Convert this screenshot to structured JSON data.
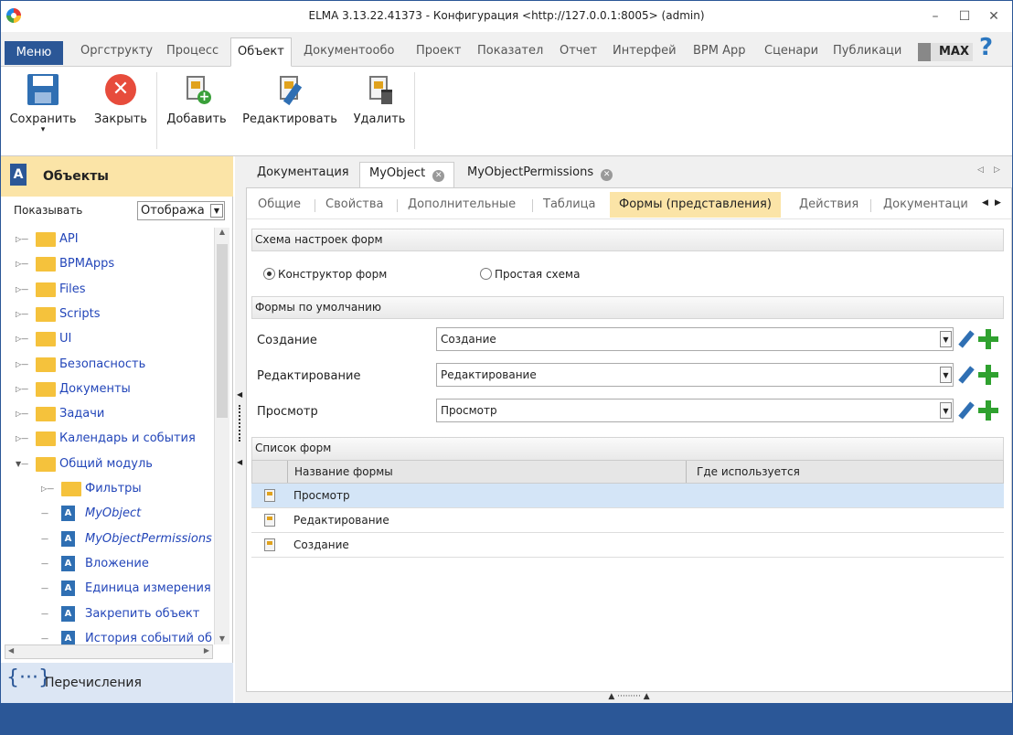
{
  "window": {
    "title": "ELMA 3.13.22.41373 - Конфигурация <http://127.0.0.1:8005> (admin)",
    "minimize": "–",
    "maximize": "☐",
    "close": "✕"
  },
  "menu": {
    "menu_label": "Меню",
    "tabs": [
      "Оргструкту",
      "Процесс",
      "Объект",
      "Документообо",
      "Проект",
      "Показател",
      "Отчет",
      "Интерфей",
      "BPM App",
      "Сценари",
      "Публикаци"
    ],
    "active_tab": "Объект",
    "user_badge": "MAX",
    "help": "?"
  },
  "ribbon": {
    "save": "Сохранить",
    "close": "Закрыть",
    "add": "Добавить",
    "edit": "Редактировать",
    "delete": "Удалить",
    "save_arrow": "▾",
    "close_glyph": "✕",
    "plus_glyph": "+"
  },
  "left": {
    "title": "Объекты",
    "title_icon": "A",
    "filter_label": "Показывать",
    "filter_value": "Отобража",
    "tree": [
      {
        "label": "API",
        "type": "folder",
        "level": 0,
        "state": "collapsed"
      },
      {
        "label": "BPMApps",
        "type": "folder",
        "level": 0,
        "state": "collapsed"
      },
      {
        "label": "Files",
        "type": "folder",
        "level": 0,
        "state": "collapsed"
      },
      {
        "label": "Scripts",
        "type": "folder",
        "level": 0,
        "state": "collapsed"
      },
      {
        "label": "UI",
        "type": "folder",
        "level": 0,
        "state": "collapsed"
      },
      {
        "label": "Безопасность",
        "type": "folder",
        "level": 0,
        "state": "collapsed"
      },
      {
        "label": "Документы",
        "type": "folder",
        "level": 0,
        "state": "collapsed"
      },
      {
        "label": "Задачи",
        "type": "folder",
        "level": 0,
        "state": "collapsed"
      },
      {
        "label": "Календарь и события",
        "type": "folder",
        "level": 0,
        "state": "collapsed"
      },
      {
        "label": "Общий модуль",
        "type": "folder",
        "level": 0,
        "state": "expanded"
      },
      {
        "label": "Фильтры",
        "type": "folder",
        "level": 1,
        "state": "collapsed"
      },
      {
        "label": "MyObject",
        "type": "class",
        "level": 1,
        "italic": true
      },
      {
        "label": "MyObjectPermissions",
        "type": "class",
        "level": 1,
        "italic": true
      },
      {
        "label": "Вложение",
        "type": "class",
        "level": 1
      },
      {
        "label": "Единица измерения",
        "type": "class",
        "level": 1
      },
      {
        "label": "Закрепить объект",
        "type": "class",
        "level": 1
      },
      {
        "label": "История событий об",
        "type": "class",
        "level": 1
      }
    ],
    "enum_icon": "{···}",
    "enum_label": "Перечисления"
  },
  "doc_tabs": [
    {
      "label": "Документация",
      "active": false,
      "closable": false
    },
    {
      "label": "MyObject",
      "active": true,
      "closable": true
    },
    {
      "label": "MyObjectPermissions",
      "active": false,
      "closable": true
    }
  ],
  "sub_tabs": [
    "Общие",
    "Свойства",
    "Дополнительные",
    "Таблица",
    "Формы (представления)",
    "Действия",
    "Документаци"
  ],
  "active_sub_tab": "Формы (представления)",
  "forms": {
    "scheme_header": "Схема настроек форм",
    "radio_constructor": "Конструктор форм",
    "radio_simple": "Простая схема",
    "selected_scheme": "constructor",
    "defaults_header": "Формы по умолчанию",
    "defaults": [
      {
        "label": "Создание",
        "value": "Создание"
      },
      {
        "label": "Редактирование",
        "value": "Редактирование"
      },
      {
        "label": "Просмотр",
        "value": "Просмотр"
      }
    ],
    "list_header": "Список форм",
    "columns": [
      "Название формы",
      "Где используется"
    ],
    "rows": [
      {
        "name": "Просмотр",
        "where": "",
        "selected": true
      },
      {
        "name": "Редактирование",
        "where": ""
      },
      {
        "name": "Создание",
        "where": ""
      }
    ]
  }
}
